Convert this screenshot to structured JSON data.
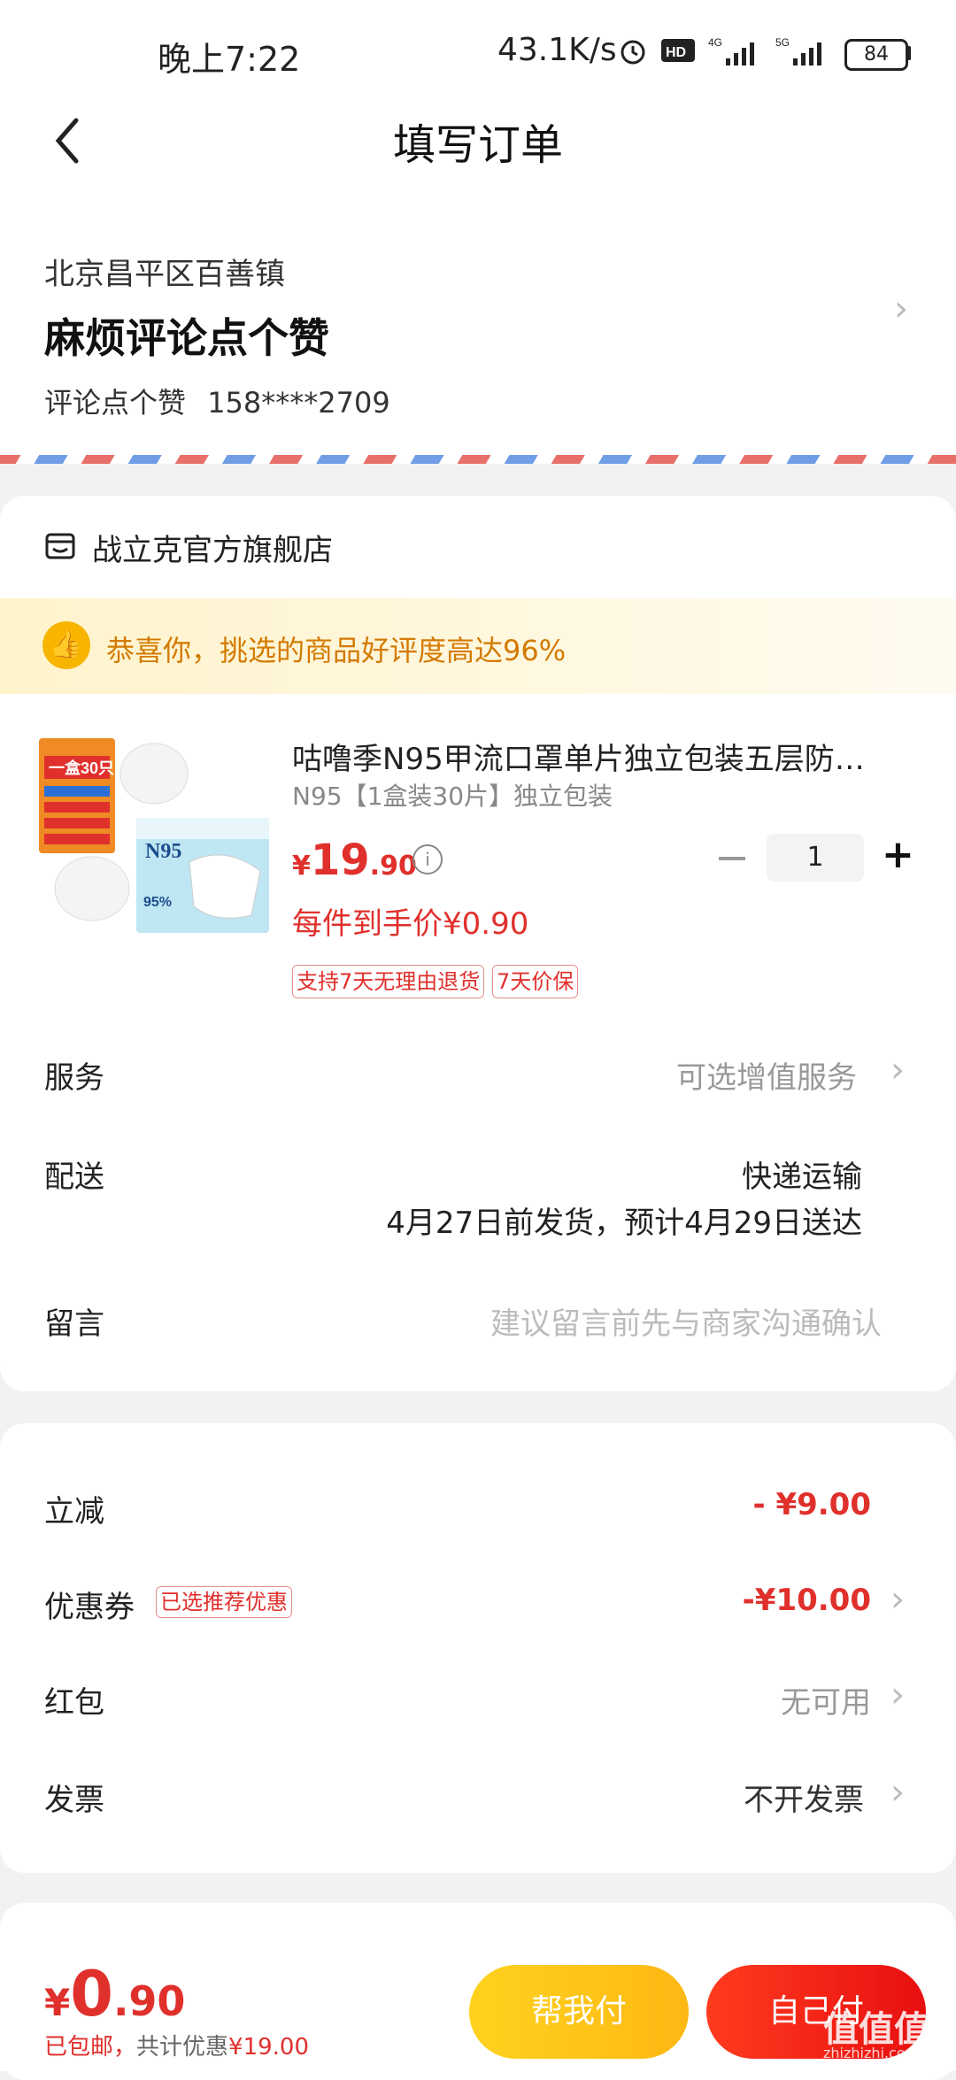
{
  "status_bar": {
    "time": "晚上7:22",
    "speed": "43.1K/s",
    "battery": "84"
  },
  "header": {
    "title": "填写订单"
  },
  "address": {
    "region": "北京昌平区百善镇",
    "name": "麻烦评论点个赞",
    "contact_name": "评论点个赞",
    "phone": "158****2709"
  },
  "shop": {
    "name": "战立克官方旗舰店",
    "praise_text": "恭喜你，挑选的商品好评度高达96%"
  },
  "product": {
    "title": "咕噜季N95甲流口罩单片独立包装五层防…",
    "spec": "N95【1盒装30片】独立包装",
    "price_currency": "¥",
    "price_int": "19",
    "price_dec": ".90",
    "unit_price": "每件到手价¥0.90",
    "quantity": "1",
    "tags": [
      "支持7天无理由退货",
      "7天价保"
    ],
    "image_texts": {
      "box_label": "N95",
      "badge": "一盒30只",
      "percent": "95%"
    }
  },
  "rows": {
    "service_label": "服务",
    "service_value": "可选增值服务",
    "delivery_label": "配送",
    "delivery_method": "快递运输",
    "delivery_eta": "4月27日前发货，预计4月29日送达",
    "note_label": "留言",
    "note_placeholder": "建议留言前先与商家沟通确认"
  },
  "summary": {
    "discount_label": "立减",
    "discount_value": "- ¥9.00",
    "coupon_label": "优惠券",
    "coupon_badge": "已选推荐优惠",
    "coupon_value": "-¥10.00",
    "redpacket_label": "红包",
    "redpacket_value": "无可用",
    "invoice_label": "发票",
    "invoice_value": "不开发票"
  },
  "bottom": {
    "total_currency": "¥",
    "total_int": "0",
    "total_dec": ".90",
    "shipping_note": "已包邮，",
    "saving_label": "共计优惠",
    "saving_value": "¥19.00",
    "help_pay_label": "帮我付",
    "self_pay_label": "自己付",
    "watermark": "值值值",
    "watermark_url": "zhizhizhi.com"
  },
  "colors": {
    "accent_red": "#e0302c",
    "accent_yellow": "#fdb813",
    "praise_text": "#d47a00"
  },
  "icons": {
    "back": "chevron-left-icon",
    "shop": "store-icon",
    "praise": "thumbs-up-icon",
    "info": "info-icon",
    "chevron": "chevron-right-icon"
  }
}
